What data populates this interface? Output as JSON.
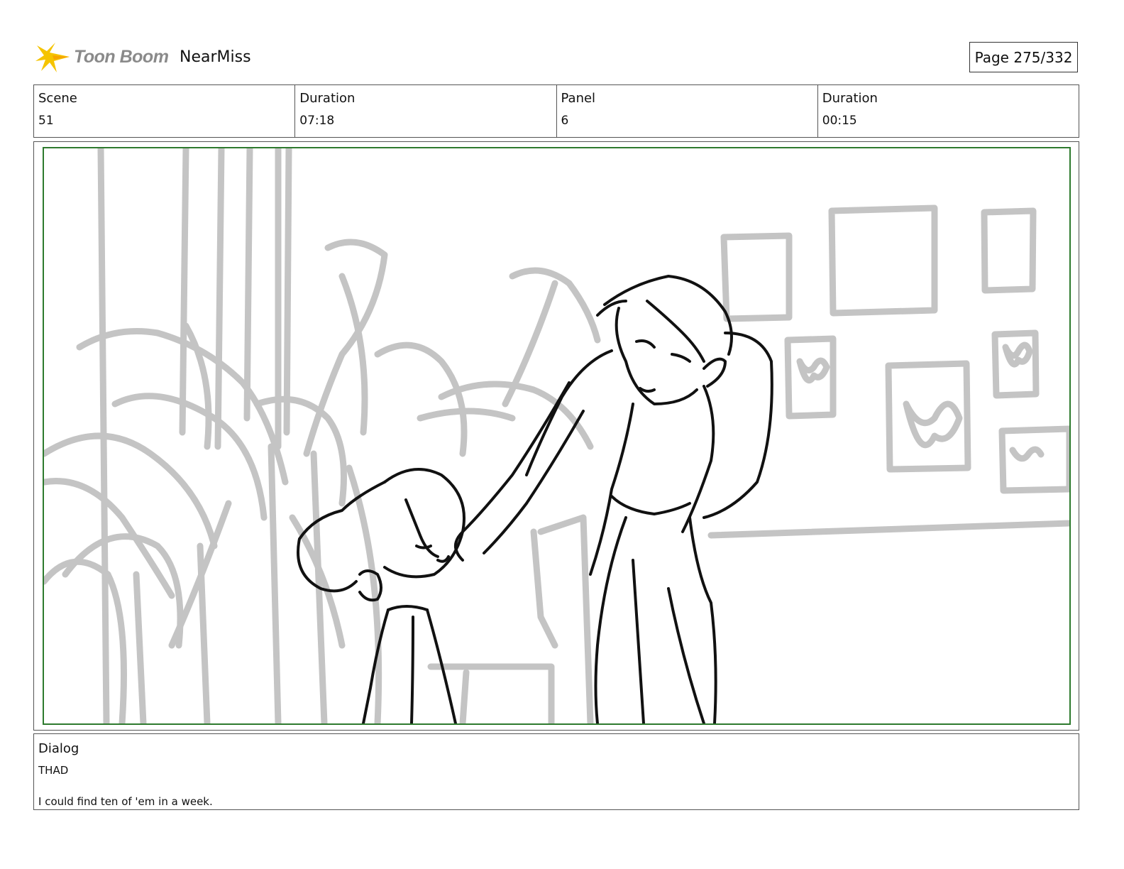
{
  "header": {
    "brand": "Toon Boom",
    "project_name": "NearMiss",
    "page_label": "Page 275/332"
  },
  "info": {
    "scene_label": "Scene",
    "scene_value": "51",
    "scene_duration_label": "Duration",
    "scene_duration_value": "07:18",
    "panel_label": "Panel",
    "panel_value": "6",
    "panel_duration_label": "Duration",
    "panel_duration_value": "00:15"
  },
  "colors": {
    "frame_border": "#2e7a2e",
    "sketch_gray": "#c4c4c4",
    "sketch_ink": "#111111",
    "logo_yellow": "#f5c400"
  },
  "panel": {
    "image_icon": "storyboard-sketch-image"
  },
  "dialog": {
    "label": "Dialog",
    "speaker": "THAD",
    "line": "I could find ten of 'em in a week."
  }
}
